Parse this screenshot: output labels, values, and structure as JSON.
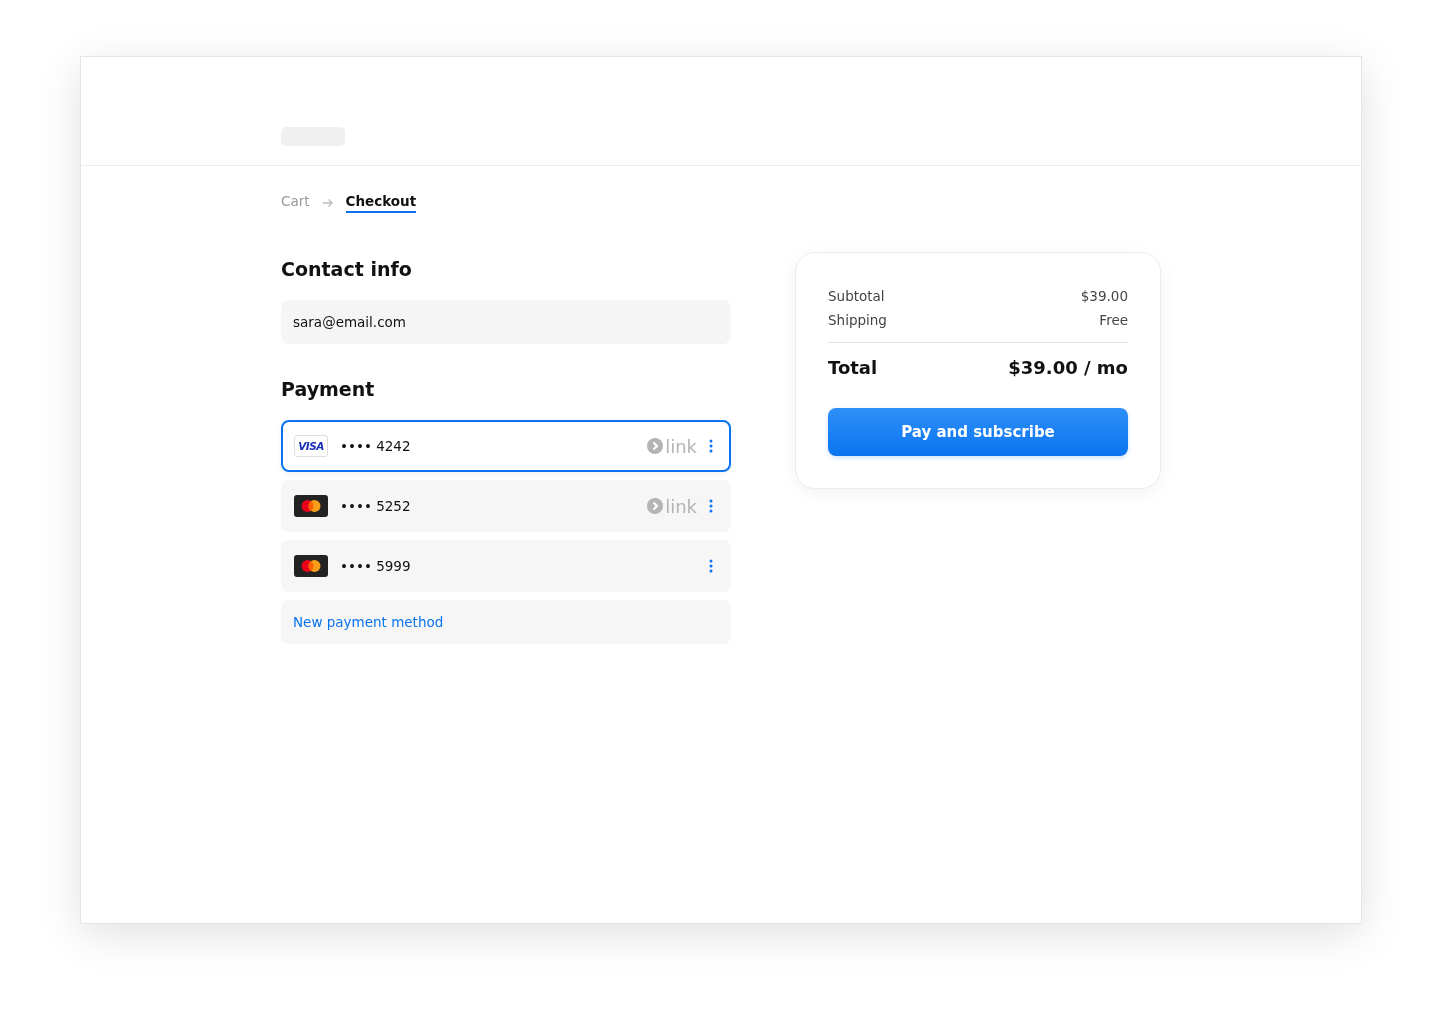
{
  "breadcrumb": [
    {
      "label": "Cart",
      "selected": false
    },
    {
      "label": "Checkout",
      "selected": true
    }
  ],
  "contact": {
    "heading": "Contact info",
    "email": "sara@email.com"
  },
  "payment": {
    "heading": "Payment",
    "methods": [
      {
        "kind": "visa",
        "brand": "VISA",
        "number": "•••• 4242",
        "link": "link",
        "selected": true
      },
      {
        "kind": "mastercard",
        "number": "•••• 5252",
        "link": "link",
        "selected": false
      },
      {
        "kind": "mastercard",
        "number": "•••• 5999",
        "selected": false
      }
    ],
    "new_method": "New payment method"
  },
  "summary": {
    "lines": [
      {
        "label": "Subtotal",
        "value": "$39.00"
      },
      {
        "label": "Shipping",
        "value": "Free"
      }
    ],
    "total_label": "Total",
    "total_value": "$39.00 / mo",
    "button": "Pay and subscribe"
  }
}
